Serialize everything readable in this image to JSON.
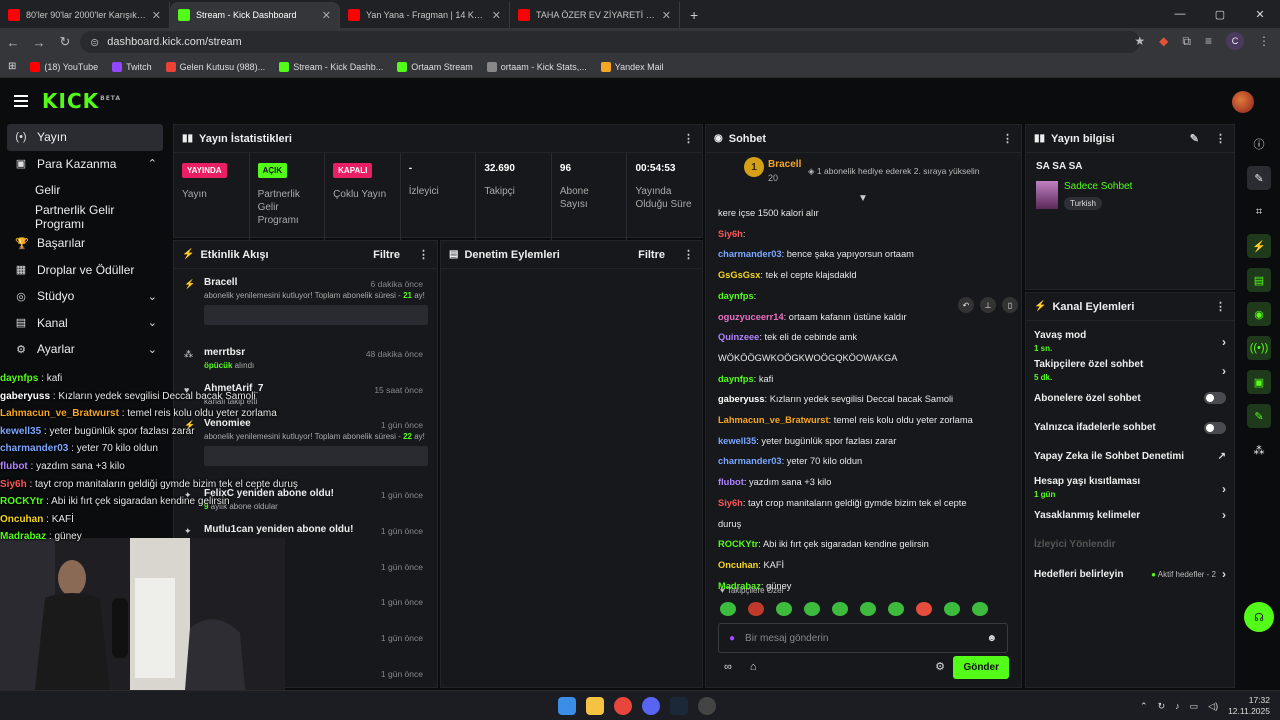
{
  "browser": {
    "tabs": [
      {
        "title": "80'ler 90'lar 2000'ler Karışık Türkçe",
        "color": "#ff0000",
        "active": false
      },
      {
        "title": "Stream - Kick Dashboard",
        "color": "#53fc18",
        "active": true
      },
      {
        "title": "Yan Yana - Fragman | 14 Kasım",
        "color": "#ff0000",
        "active": false
      },
      {
        "title": "TAHA ÖZER EV ZİYARETİ - YouTube",
        "color": "#ff0000",
        "active": false
      }
    ],
    "url": "dashboard.kick.com/stream",
    "profile_initial": "C",
    "bookmarks": [
      {
        "label": "(18) YouTube",
        "color": "#ff0000"
      },
      {
        "label": "Twitch",
        "color": "#9146ff"
      },
      {
        "label": "Gelen Kutusu (988)...",
        "color": "#ea4335"
      },
      {
        "label": "Stream - Kick Dashb...",
        "color": "#53fc18"
      },
      {
        "label": "Ortaam Stream",
        "color": "#53fc18"
      },
      {
        "label": "ortaam - Kick Stats,...",
        "color": "#888888"
      },
      {
        "label": "Yandex Mail",
        "color": "#f5a623"
      }
    ]
  },
  "app": {
    "logo": "KICK",
    "logo_sup": "BETA"
  },
  "sidebar": {
    "items": [
      {
        "label": "Yayın",
        "icon": "broadcast-icon",
        "glyph": "(•)"
      },
      {
        "label": "Para Kazanma",
        "icon": "money-icon",
        "glyph": "▣"
      },
      {
        "label": "Gelir"
      },
      {
        "label": "Partnerlik Gelir Programı"
      },
      {
        "label": "Başarılar",
        "icon": "trophy-icon",
        "glyph": "🏆"
      },
      {
        "label": "Droplar ve Ödüller",
        "icon": "gift-icon",
        "glyph": "▦"
      },
      {
        "label": "Stüdyo",
        "icon": "studio-icon",
        "glyph": "◎"
      },
      {
        "label": "Kanal",
        "icon": "channel-icon",
        "glyph": "▤"
      },
      {
        "label": "Ayarlar",
        "icon": "gear-icon",
        "glyph": "⚙"
      }
    ]
  },
  "overlay_chat": [
    {
      "user": "daynfps",
      "msg": "kafi",
      "color": "#53fc18"
    },
    {
      "user": "gaberyuss",
      "msg": "Kızların yedek sevgilisi Deccal bacak Samoli",
      "color": "#ffffff"
    },
    {
      "user": "Lahmacun_ve_Bratwurst",
      "msg": "temel reis kolu oldu yeter zorlama",
      "color": "#f5a623"
    },
    {
      "user": "kewell35",
      "msg": "yeter bugünlük spor fazlası zarar",
      "color": "#7aa7ff"
    },
    {
      "user": "charmander03",
      "msg": "yeter 70 kilo oldun",
      "color": "#7aa7ff"
    },
    {
      "user": "flubot",
      "msg": "yazdım sana +3 kilo",
      "color": "#b083ff"
    },
    {
      "user": "Siy6h",
      "msg": "tayt crop manitaların geldiği gymde bizim tek el cepte duruş",
      "color": "#ff5555"
    },
    {
      "user": "ROCKYtr",
      "msg": "Abi iki fırt çek sigaradan kendine gelirsin",
      "color": "#53fc18"
    },
    {
      "user": "Oncuhan",
      "msg": "KAFİ",
      "color": "#f5d623"
    },
    {
      "user": "Madrabaz",
      "msg": "güney",
      "color": "#53fc18"
    }
  ],
  "stats_panel": {
    "title": "Yayın İstatistikleri",
    "stats": [
      {
        "badge": "YAYINDA",
        "badge_color": "#e91e63",
        "label": "Yayın"
      },
      {
        "badge": "AÇIK",
        "badge_color": "#53fc18",
        "label": "Partnerlik Gelir Programı"
      },
      {
        "badge": "KAPALI",
        "badge_color": "#e91e63",
        "label": "Çoklu Yayın"
      },
      {
        "value": "-",
        "label": "İzleyici"
      },
      {
        "value": "32.690",
        "label": "Takipçi"
      },
      {
        "value": "96",
        "label": "Abone Sayısı"
      },
      {
        "value": "00:54:53",
        "label": "Yayında Olduğu Süre"
      }
    ]
  },
  "activity_panel": {
    "title": "Etkinlik Akışı",
    "filter": "Filtre",
    "items": [
      {
        "name": "Bracell",
        "time": "6 dakika önce",
        "desc": "abonelik yenilemesini kutluyor! Toplam abonelik süresi -",
        "highlight": "21",
        "suffix": " ay!",
        "box": true
      },
      {
        "name": "merrtbsr",
        "time": "48 dakika önce",
        "desc": "",
        "highlight": "öpücük",
        "suffix": " alındı",
        "box": false
      },
      {
        "name": "AhmetArif_7",
        "time": "15 saat önce",
        "desc": "kanalı takip etti",
        "highlight": "",
        "suffix": "",
        "box": false
      },
      {
        "name": "Venomiee",
        "time": "1 gün önce",
        "desc": "abonelik yenilemesini kutluyor! Toplam abonelik süresi -",
        "highlight": "22",
        "suffix": " ay!",
        "box": true
      },
      {
        "name": "FelixC yeniden abone oldu!",
        "time": "1 gün önce",
        "desc": "",
        "highlight": "9",
        "suffix": " aylık abone oldular",
        "box": false
      },
      {
        "name": "Mutlu1can yeniden abone oldu!",
        "time": "1 gün önce",
        "desc": "",
        "highlight": "",
        "suffix": "",
        "box": false
      },
      {
        "name": "",
        "time": "1 gün önce",
        "desc": "",
        "highlight": "",
        "suffix": "",
        "box": false
      },
      {
        "name": "",
        "time": "1 gün önce",
        "desc": "",
        "highlight": "",
        "suffix": "",
        "box": false
      },
      {
        "name": "",
        "time": "1 gün önce",
        "desc": "",
        "highlight": "",
        "suffix": "",
        "box": false
      },
      {
        "name": "",
        "time": "1 gün önce",
        "desc": "",
        "highlight": "",
        "suffix": "",
        "box": false
      }
    ]
  },
  "moderation_panel": {
    "title": "Denetim Eylemleri",
    "filter": "Filtre"
  },
  "chat_panel": {
    "title": "Sohbet",
    "pinned_user": "Bracell",
    "pinned_rank": "1",
    "pinned_count": "20",
    "pinned_msg": "1 abonelik hediye ederek 2. sıraya yükselin",
    "messages": [
      {
        "user": "",
        "msg": "kere içse 1500 kalori alır",
        "color": "#ffffff"
      },
      {
        "user": "Siy6h",
        "msg": "",
        "color": "#ff5555"
      },
      {
        "user": "charmander03",
        "msg": "bence şaka yapıyorsun ortaam",
        "color": "#7aa7ff"
      },
      {
        "user": "GsGsGsx",
        "msg": "tek el cepte klajsdakld",
        "color": "#f5d623"
      },
      {
        "user": "daynfps",
        "msg": "",
        "color": "#53fc18"
      },
      {
        "user": "oguzyuceerr14",
        "msg": "ortaam kafanın üstüne kaldır",
        "color": "#e86fc4"
      },
      {
        "user": "Quinzeee",
        "msg": "tek eli de cebinde amk",
        "color": "#b083ff"
      },
      {
        "user": "",
        "msg": "WÖKÖÖGWKOÖGKWOÖGQKÖOWAKGA",
        "color": "#ffffff"
      },
      {
        "user": "daynfps",
        "msg": "kafi",
        "color": "#53fc18"
      },
      {
        "user": "gaberyuss",
        "msg": "Kızların yedek sevgilisi Deccal bacak Samoli",
        "color": "#ffffff"
      },
      {
        "user": "Lahmacun_ve_Bratwurst",
        "msg": "temel reis kolu oldu yeter zorlama",
        "color": "#f5a623"
      },
      {
        "user": "kewell35",
        "msg": "yeter bugünlük spor fazlası zarar",
        "color": "#7aa7ff"
      },
      {
        "user": "charmander03",
        "msg": "yeter 70 kilo oldun",
        "color": "#7aa7ff"
      },
      {
        "user": "flubot",
        "msg": "yazdım sana +3 kilo",
        "color": "#b083ff"
      },
      {
        "user": "Siy6h",
        "msg": "tayt crop manitaların geldiği gymde bizim tek el cepte",
        "color": "#ff5555"
      },
      {
        "user": "",
        "msg": "duruş",
        "color": "#ffffff"
      },
      {
        "user": "ROCKYtr",
        "msg": "Abi iki fırt çek sigaradan kendine gelirsin",
        "color": "#53fc18"
      },
      {
        "user": "Oncuhan",
        "msg": "KAFİ",
        "color": "#f5d623"
      },
      {
        "user": "Madrabaz",
        "msg": "güney",
        "color": "#53fc18"
      }
    ],
    "followers_emotes_label": "Takipçilere Özel",
    "input_placeholder": "Bir mesaj gönderin",
    "send_label": "Gönder"
  },
  "stream_info": {
    "title": "Yayın bilgisi",
    "stream_title": "SA SA SA",
    "category": "Sadece Sohbet",
    "tag": "Turkish"
  },
  "channel_actions": {
    "title": "Kanal Eylemleri",
    "items": [
      {
        "label": "Yavaş mod",
        "sub": "1 sn.",
        "kind": "arrow"
      },
      {
        "label": "Takipçilere özel sohbet",
        "sub": "5 dk.",
        "kind": "arrow"
      },
      {
        "label": "Abonelere özel sohbet",
        "sub": "",
        "kind": "toggle"
      },
      {
        "label": "Yalnızca ifadelerle sohbet",
        "sub": "",
        "kind": "toggle"
      },
      {
        "label": "Yapay Zeka ile Sohbet Denetimi",
        "sub": "",
        "kind": "ext"
      },
      {
        "label": "Hesap yaşı kısıtlaması",
        "sub": "1 gün",
        "kind": "arrow"
      },
      {
        "label": "Yasaklanmış kelimeler",
        "sub": "",
        "kind": "arrow"
      },
      {
        "label": "İzleyici Yönlendir",
        "sub": "",
        "kind": "disabled"
      },
      {
        "label": "Hedefleri belirleyin",
        "sub": "",
        "kind": "goal",
        "status": "Aktif hedefler - 2"
      }
    ]
  },
  "taskbar": {
    "time": "17:32",
    "date": "12.11.2025"
  }
}
